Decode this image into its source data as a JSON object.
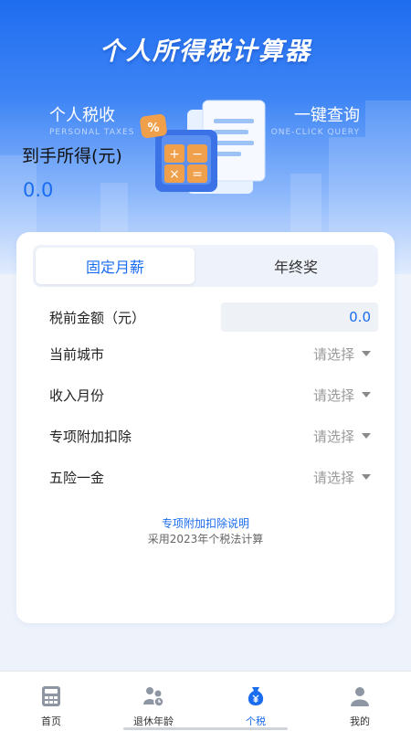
{
  "header": {
    "title": "个人所得税计算器",
    "left_title": "个人税收",
    "left_subtitle": "PERSONAL TAXES",
    "right_title": "一键查询",
    "right_subtitle": "ONE-CLICK QUERY",
    "net_income_label": "到手所得(元)",
    "net_income_value": "0.0",
    "percent_symbol": "%"
  },
  "segments": [
    {
      "label": "固定月薪",
      "active": true
    },
    {
      "label": "年终奖",
      "active": false
    }
  ],
  "form": {
    "pretax": {
      "label": "税前金额（元）",
      "value": "0.0"
    },
    "city": {
      "label": "当前城市",
      "value": "请选择"
    },
    "month": {
      "label": "收入月份",
      "value": "请选择"
    },
    "deduction": {
      "label": "专项附加扣除",
      "value": "请选择"
    },
    "insurance": {
      "label": "五险一金",
      "value": "请选择"
    }
  },
  "footer_link": "专项附加扣除说明",
  "footer_note": "采用2023年个税法计算",
  "tabbar": [
    {
      "label": "首页",
      "icon": "calculator-icon",
      "active": false
    },
    {
      "label": "退休年龄",
      "icon": "people-icon",
      "active": false
    },
    {
      "label": "个税",
      "icon": "money-bag-icon",
      "active": true
    },
    {
      "label": "我的",
      "icon": "user-icon",
      "active": false
    }
  ],
  "colors": {
    "accent": "#1a6cf0",
    "hero_top": "#1f6df0",
    "background": "#eef3fb"
  }
}
